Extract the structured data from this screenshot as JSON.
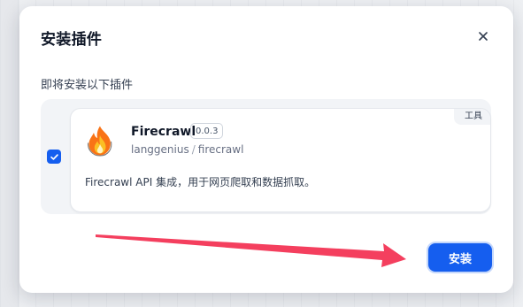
{
  "modal": {
    "title": "安装插件",
    "subtitle": "即将安装以下插件",
    "install_label": "安装"
  },
  "plugin": {
    "selected": true,
    "name": "Firecrawl",
    "version": "0.0.3",
    "org": "langgenius",
    "org_separator": "/",
    "slug": "firecrawl",
    "category": "工具",
    "description": "Firecrawl API 集成，用于网页爬取和数据抓取。",
    "icon": "flame-icon"
  },
  "annotation": {
    "arrow_color": "#f43f5e",
    "pointing_to": "install-button"
  },
  "colors": {
    "primary": "#155eef",
    "title_text": "#101828",
    "body_text": "#354052",
    "muted_text": "#676f83"
  }
}
